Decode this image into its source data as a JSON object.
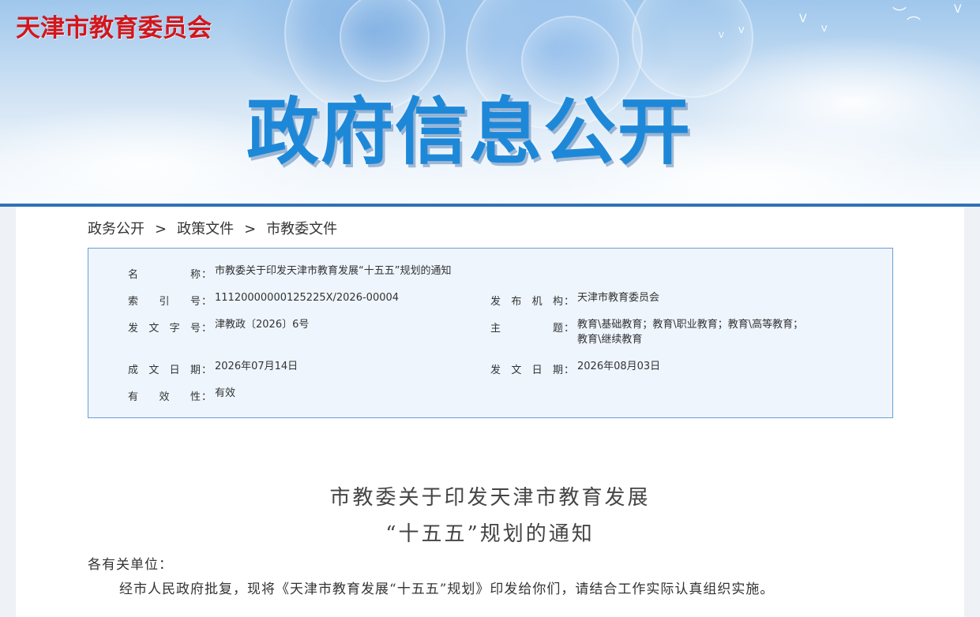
{
  "header": {
    "site_title": "天津市教育委员会",
    "banner_heading": "政府信息公开"
  },
  "breadcrumb": [
    "政务公开",
    "政策文件",
    "市教委文件"
  ],
  "breadcrumb_separator": ">",
  "metadata": {
    "name": {
      "label": "名称",
      "value": "市教委关于印发天津市教育发展“十五五”规划的通知"
    },
    "index_no": {
      "label": "索引号",
      "value": "11120000000125225X/2026-00004"
    },
    "issuer": {
      "label": "发布机构",
      "value": "天津市教育委员会"
    },
    "doc_no": {
      "label": "发文字号",
      "value": "津教政〔2026〕6号"
    },
    "subject": {
      "label": "主题",
      "value_line1": "教育\\基础教育；教育\\职业教育；教育\\高等教育；",
      "value_line2": "教育\\继续教育"
    },
    "created_date": {
      "label": "成文日期",
      "value": "2026年07月14日"
    },
    "published_date": {
      "label": "发文日期",
      "value": "2026年08月03日"
    },
    "validity": {
      "label": "有效性",
      "value": "有效"
    },
    "colon": "："
  },
  "article": {
    "title_line1": "市教委关于印发天津市教育发展",
    "title_line2": "“十五五”规划的通知",
    "salutation": "各有关单位：",
    "paragraph1": "经市人民政府批复，现将《天津市教育发展“十五五”规划》印发给你们，请结合工作实际认真组织实施。"
  }
}
